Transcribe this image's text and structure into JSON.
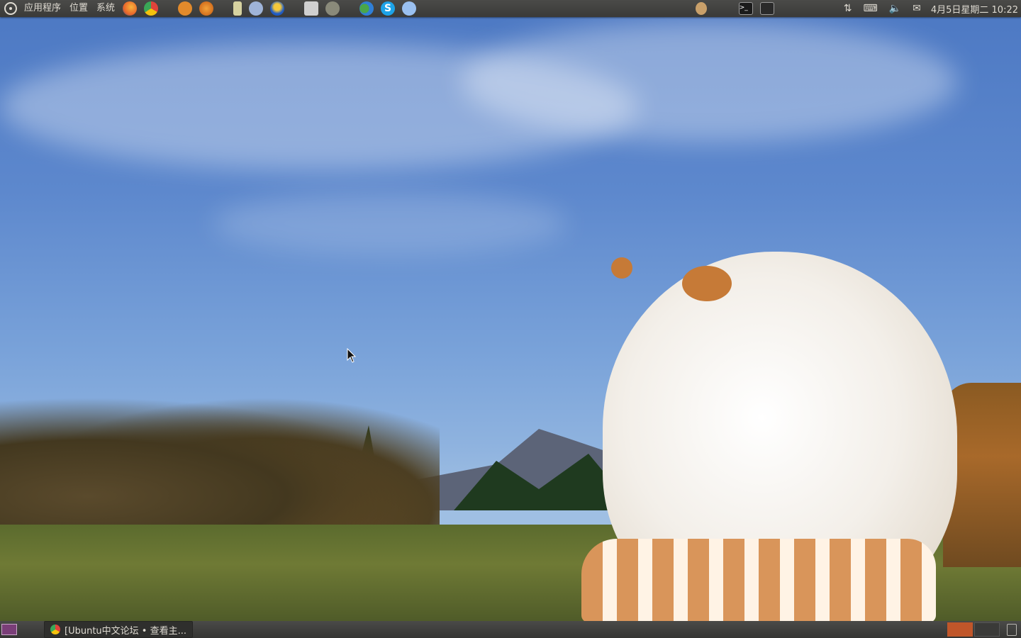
{
  "top_panel": {
    "menus": [
      "应用程序",
      "位置",
      "系统"
    ],
    "launchers": [
      {
        "name": "firefox-icon",
        "color": "#e8662a"
      },
      {
        "name": "chrome-icon",
        "color": "#4b8bf4"
      },
      {
        "name": "fish-icon",
        "color": "#e28a2b"
      },
      {
        "name": "swirl-icon",
        "color": "#e07a1a"
      },
      {
        "name": "media-player-icon",
        "color": "#d6d2a0"
      },
      {
        "name": "wine-icon",
        "color": "#9fb4d8"
      },
      {
        "name": "qq-icon",
        "color": "#1f5bc4"
      },
      {
        "name": "screenshot-icon",
        "color": "#cfcfcf"
      },
      {
        "name": "gimp-icon",
        "color": "#8a8a7a"
      },
      {
        "name": "pidgin-icon",
        "color": "#4aa64a"
      },
      {
        "name": "skype-icon",
        "color": "#1da3e8"
      },
      {
        "name": "rabbit-icon",
        "color": "#9ac0f0"
      }
    ],
    "indicators": [
      "rabbit-tray-icon",
      "terminal-icon",
      "terminal-alt-icon"
    ],
    "clock": "4月5日星期二 10:22"
  },
  "bottom_panel": {
    "task_title": "[Ubuntu中文论坛 • 查看主...",
    "workspace_colors": [
      "#c0562a",
      "#3a3a38"
    ]
  }
}
